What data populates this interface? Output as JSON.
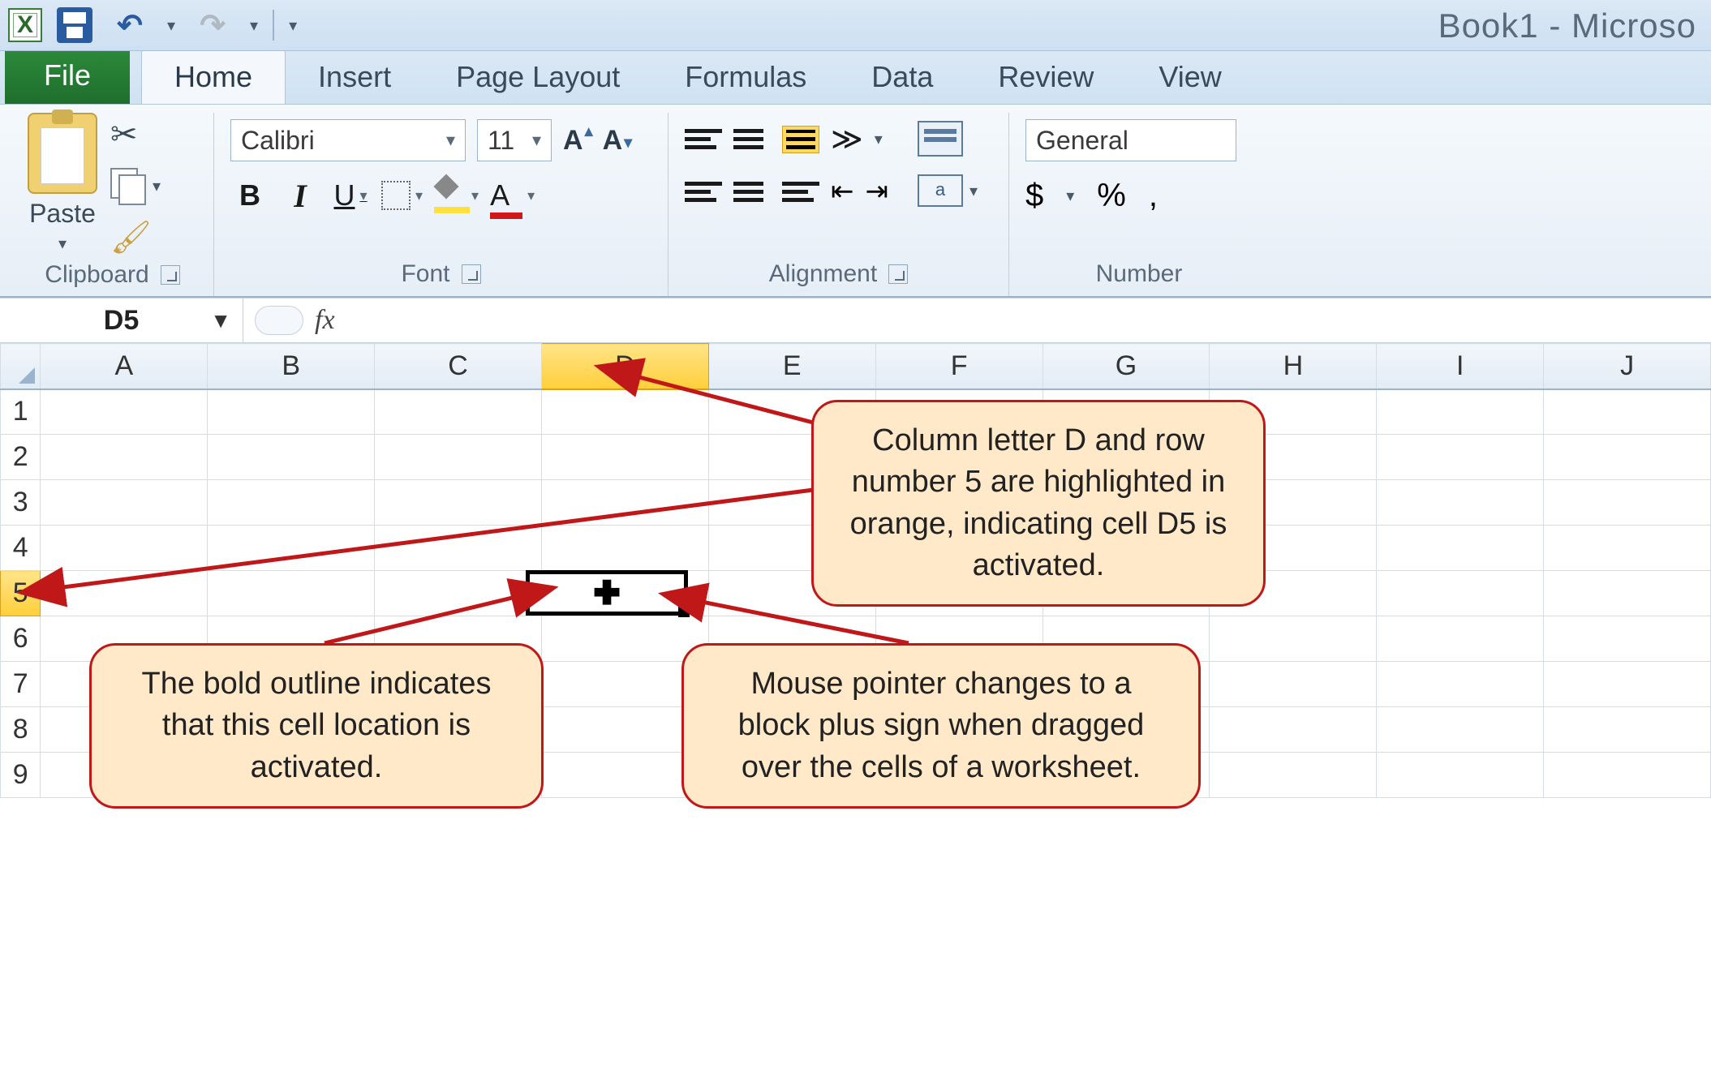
{
  "title": "Book1 - Microso",
  "qat": {
    "undo": "↶",
    "redo": "↷"
  },
  "tabs": {
    "file": "File",
    "list": [
      "Home",
      "Insert",
      "Page Layout",
      "Formulas",
      "Data",
      "Review",
      "View"
    ],
    "active": 0
  },
  "ribbon": {
    "clipboard": {
      "paste": "Paste",
      "label": "Clipboard"
    },
    "font": {
      "name": "Calibri",
      "size": "11",
      "growA": "A",
      "shrinkA": "A",
      "bold": "B",
      "italic": "I",
      "underline": "U",
      "fontcolorA": "A",
      "label": "Font"
    },
    "alignment": {
      "label": "Alignment",
      "orient": "≫"
    },
    "number": {
      "format": "General",
      "dollar": "$",
      "percent": "%",
      "comma": ",",
      "label": "Number"
    }
  },
  "namebox": "D5",
  "fx": "fx",
  "columns": [
    "A",
    "B",
    "C",
    "D",
    "E",
    "F",
    "G",
    "H",
    "I",
    "J"
  ],
  "rows": [
    "1",
    "2",
    "3",
    "4",
    "5",
    "6",
    "7",
    "8",
    "9"
  ],
  "active": {
    "col": "D",
    "row": "5"
  },
  "cursor": "✚",
  "callouts": {
    "c1": "Column letter D and row number 5 are highlighted in orange, indicating cell D5 is activated.",
    "c2": "The bold outline indicates that this cell location is activated.",
    "c3": "Mouse pointer changes to a block plus sign when dragged over the cells of a worksheet."
  }
}
